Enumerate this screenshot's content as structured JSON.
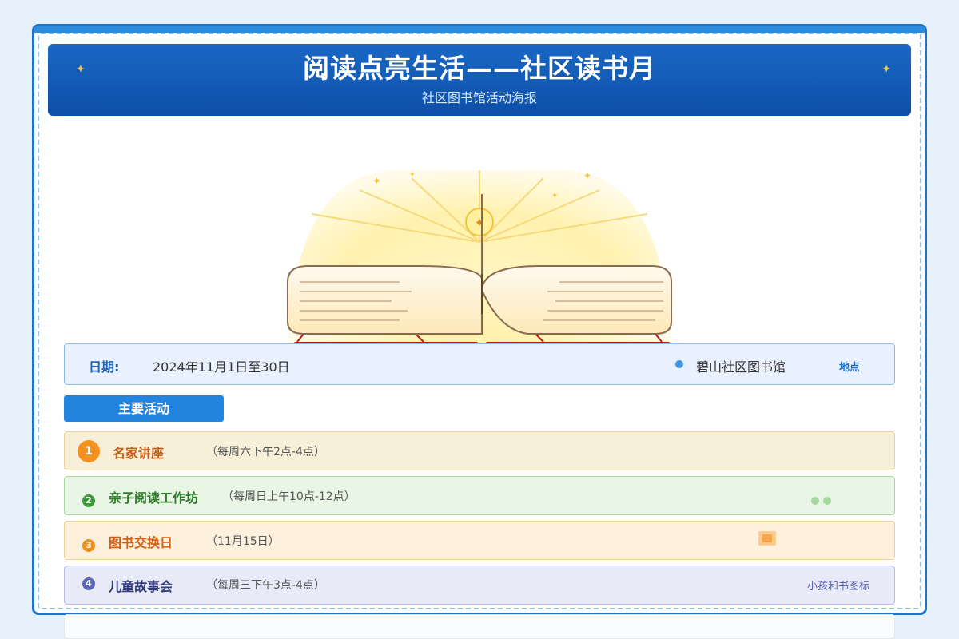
{
  "header": {
    "title": "阅读点亮生活——社区读书月",
    "subtitle": "社区图书馆活动海报"
  },
  "info": {
    "date_label": "日期:",
    "date_value": "2024年11月1日至30日",
    "location_value": "碧山社区图书馆",
    "location_label": "地点"
  },
  "section": {
    "label": "主要活动"
  },
  "activities": [
    {
      "num": "1",
      "name": "名家讲座",
      "time": "（每周六下午2点-4点）"
    },
    {
      "num": "2",
      "name": "亲子阅读工作坊",
      "time": "（每周日上午10点-12点）"
    },
    {
      "num": "3",
      "name": "图书交换日",
      "time": "（11月15日）"
    },
    {
      "num": "4",
      "name": "儿童故事会",
      "time": "（每周三下午3点-4点）",
      "tag": "小孩和书图标"
    }
  ],
  "colors": {
    "primary": "#1f72c9",
    "header_bg": "#0d4fa8",
    "book_cover": "#b71c1c",
    "glow": "#fff2b0"
  },
  "icons": [
    "sparkle-icon",
    "open-book-icon",
    "location-dot-icon"
  ]
}
